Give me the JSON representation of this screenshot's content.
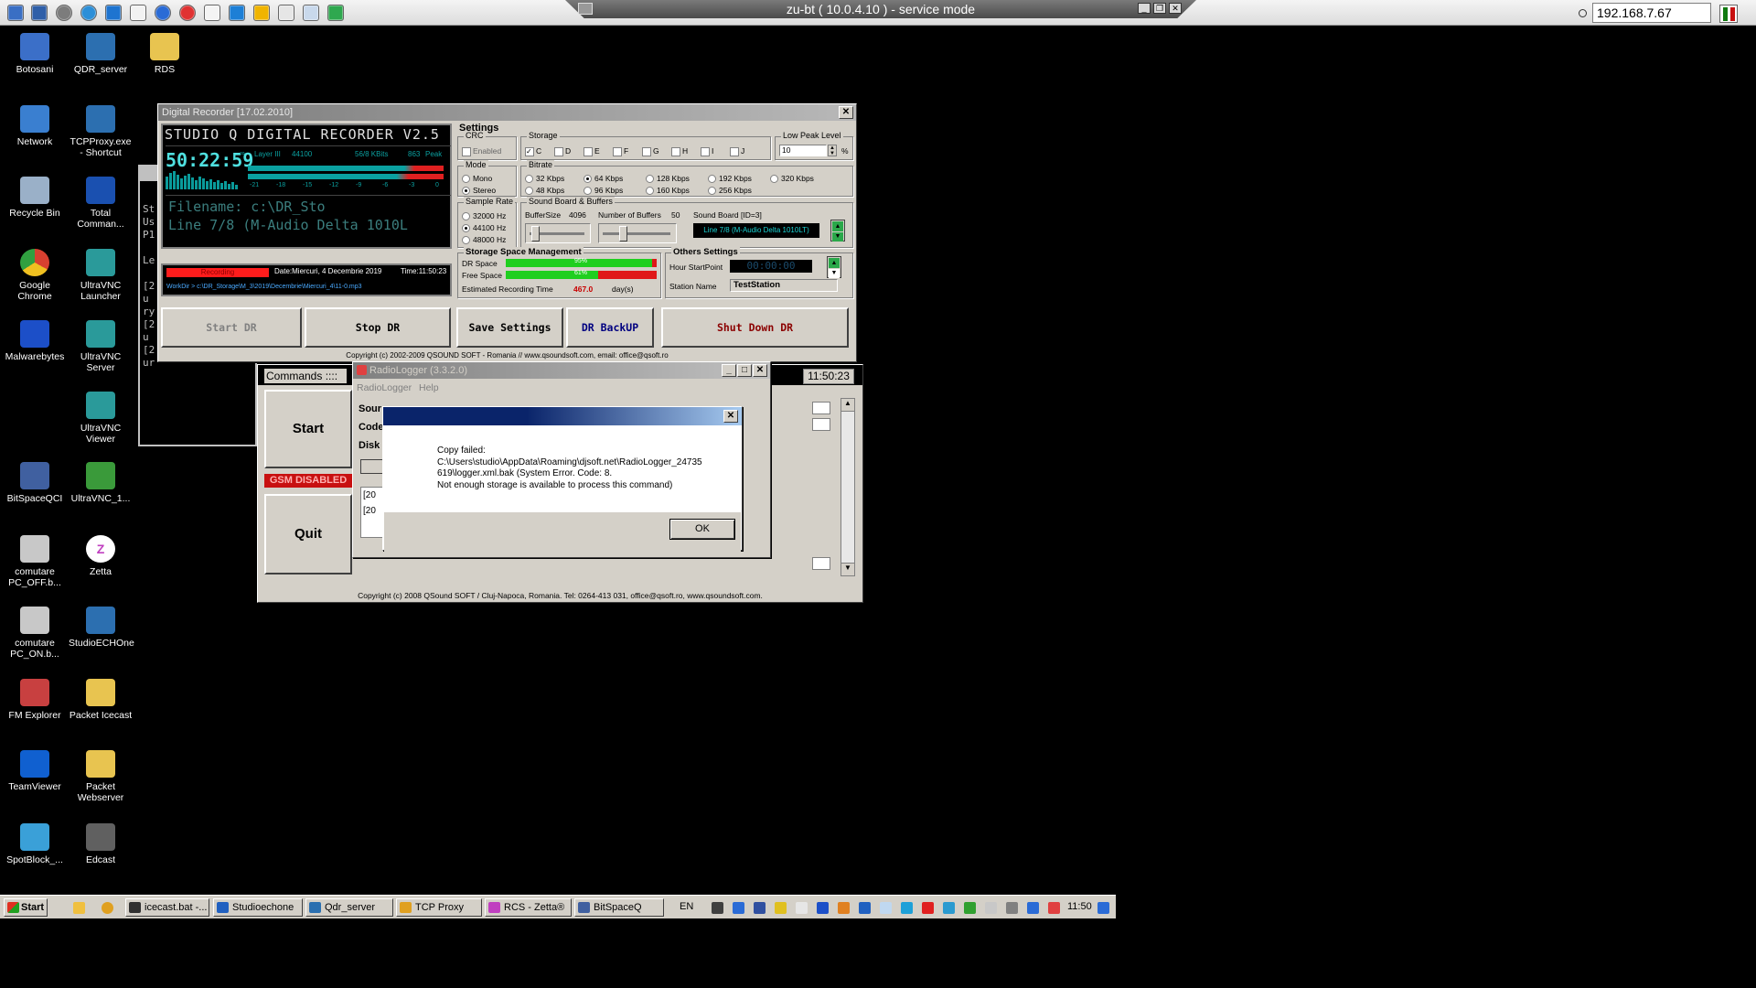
{
  "vnc": {
    "title": "zu-bt ( 10.0.4.10 ) - service mode",
    "ip": "192.168.7.67"
  },
  "desktop": {
    "icons": [
      {
        "label": "Botosani",
        "icon": "computer-icon"
      },
      {
        "label": "QDR_server",
        "icon": "app-shortcut-icon"
      },
      {
        "label": "RDS",
        "icon": "folder-icon"
      },
      {
        "label": "Network",
        "icon": "network-icon"
      },
      {
        "label": "TCPProxy.exe - Shortcut",
        "icon": "app-shortcut-icon"
      },
      {
        "label": "Recycle Bin",
        "icon": "recycle-bin-icon"
      },
      {
        "label": "Total Comman...",
        "icon": "floppy-icon"
      },
      {
        "label": "Google Chrome",
        "icon": "chrome-icon"
      },
      {
        "label": "UltraVNC Launcher",
        "icon": "vnc-icon"
      },
      {
        "label": "Malwarebytes",
        "icon": "malwarebytes-icon"
      },
      {
        "label": "UltraVNC Server",
        "icon": "vnc-icon"
      },
      {
        "label": "UltraVNC Viewer",
        "icon": "vnc-icon"
      },
      {
        "label": "BitSpaceQCI",
        "icon": "app-icon"
      },
      {
        "label": "UltraVNC_1...",
        "icon": "eye-icon"
      },
      {
        "label": "comutare PC_OFF.b...",
        "icon": "batch-file-icon"
      },
      {
        "label": "Zetta",
        "icon": "zetta-icon"
      },
      {
        "label": "comutare PC_ON.b...",
        "icon": "batch-file-icon"
      },
      {
        "label": "StudioECHOne",
        "icon": "app-shortcut-icon"
      },
      {
        "label": "FM Explorer",
        "icon": "fm-explorer-icon"
      },
      {
        "label": "Packet Icecast",
        "icon": "folder-icon"
      },
      {
        "label": "TeamViewer",
        "icon": "teamviewer-icon"
      },
      {
        "label": "Packet Webserver",
        "icon": "folder-icon"
      },
      {
        "label": "SpotBlock_...",
        "icon": "spotblock-icon"
      },
      {
        "label": "Edcast",
        "icon": "edcast-icon"
      }
    ]
  },
  "recorder": {
    "title": "Digital Recorder [17.02.2010]",
    "banner": "STUDIO Q DIGITAL RECORDER V2.5",
    "time": "50:22:59",
    "layer": "Layer III",
    "rate": "44100",
    "kbit": "56/8 KBits",
    "peak_num": "863",
    "peak_label": "Peak",
    "vu_scale": [
      "-21",
      "-18",
      "-15",
      "-12",
      "-9",
      "-6",
      "-3",
      "0"
    ],
    "filename": "Filename: c:\\DR_Sto",
    "line": "Line 7/8 (M-Audio Delta 1010L",
    "status": "Recording",
    "date": "Date:Miercuri, 4 Decembrie 2019",
    "clock": "Time:11:50:23",
    "workdir": "WorkDir > c:\\DR_Storage\\M_3\\2019\\Decembrie\\Miercuri_4\\11-0.mp3",
    "settings_title": "Settings",
    "crc": {
      "title": "CRC",
      "label": "Enabled"
    },
    "storage": {
      "title": "Storage",
      "drives": [
        "C",
        "D",
        "E",
        "F",
        "G",
        "H",
        "I",
        "J"
      ]
    },
    "low_peak": {
      "title": "Low Peak Level",
      "value": "10",
      "unit": "%"
    },
    "mode": {
      "title": "Mode",
      "options": [
        "Mono",
        "Stereo"
      ]
    },
    "bitrate": {
      "title": "Bitrate",
      "options": [
        "32 Kbps",
        "64 Kbps",
        "128 Kbps",
        "192 Kbps",
        "320 Kbps",
        "48 Kbps",
        "96 Kbps",
        "160 Kbps",
        "256 Kbps"
      ]
    },
    "sample": {
      "title": "Sample Rate",
      "options": [
        "32000 Hz",
        "44100 Hz",
        "48000 Hz"
      ]
    },
    "buffers": {
      "title": "Sound Board & Buffers",
      "buffer_label": "BufferSize",
      "buffer_val": "4096",
      "num_label": "Number of Buffers",
      "num_val": "50",
      "board_label": "Sound Board [ID=3]",
      "board_val": "Line 7/8 (M-Audio Delta 1010LT)"
    },
    "ssm": {
      "title": "Storage Space Management",
      "dr_space": "DR Space",
      "free_space": "Free Space",
      "dr_val": "95%",
      "free_val": "61%",
      "dr_level": 0.97,
      "free_level": 0.61,
      "est_label": "Estimated Recording Time",
      "est_val": "467.0",
      "est_unit": "day(s)"
    },
    "others": {
      "title": "Others Settings",
      "hour_label": "Hour StartPoint",
      "hour_val": "00:00:00",
      "station_label": "Station Name",
      "station_val": "TestStation"
    },
    "buttons": {
      "start": "Start DR",
      "stop": "Stop DR",
      "save": "Save Settings",
      "backup": "DR BackUP",
      "shutdown": "Shut Down DR"
    },
    "copyright": "Copyright (c) 2002-2009 QSOUND SOFT - Romania // www.qsoundsoft.com, email: office@qsoft.ro"
  },
  "commander": {
    "commands_label": "Commands ::::",
    "start": "Start",
    "quit": "Quit",
    "gsm": "GSM DISABLED",
    "time": "11:50:23",
    "copyright": "Copyright (c) 2008 QSound SOFT / Cluj-Napoca, Romania. Tel: 0264-413 031, office@qsoft.ro, www.qsoundsoft.com."
  },
  "radiologger": {
    "title": "RadioLogger (3.3.2.0)",
    "menu": [
      "RadioLogger",
      "Help"
    ],
    "rows": [
      "Sour",
      "Code",
      "Disk"
    ],
    "log_lines": [
      "[20",
      "[20"
    ]
  },
  "dialog": {
    "message": [
      "Copy failed:",
      "C:\\Users\\studio\\AppData\\Roaming\\djsoft.net\\RadioLogger_24735",
      "619\\logger.xml.bak (System Error.  Code: 8.",
      "Not enough storage is available to process this command)"
    ],
    "ok": "OK"
  },
  "taskbar": {
    "start": "Start",
    "items": [
      "icecast.bat -...",
      "Studioechone",
      "Qdr_server",
      "TCP Proxy",
      "RCS - Zetta®",
      "BitSpaceQ"
    ],
    "lang": "EN",
    "clock": "11:50"
  },
  "colors": {
    "desktop": "#000000",
    "win_face": "#d4d0c8",
    "caption": "#0a246a",
    "lcd_bg": "#000000",
    "lcd_text": "#00c8c8",
    "recording": "#ff2020",
    "shutdown_text": "#8b0000",
    "backup_text": "#000080"
  }
}
